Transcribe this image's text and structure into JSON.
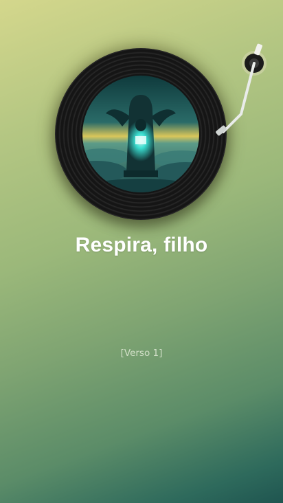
{
  "player": {
    "song_title": "Respira, filho",
    "current_lyric": "[Verso 1]"
  },
  "icons": {
    "record": "vinyl-record-icon",
    "cover": "album-cover-art",
    "tonearm": "tonearm-icon"
  },
  "colors": {
    "background_top": "#d4d78c",
    "background_bottom": "#1f5550",
    "record_black": "#151515",
    "glow_cyan": "#3ff2e2",
    "title_text": "#ffffff"
  }
}
